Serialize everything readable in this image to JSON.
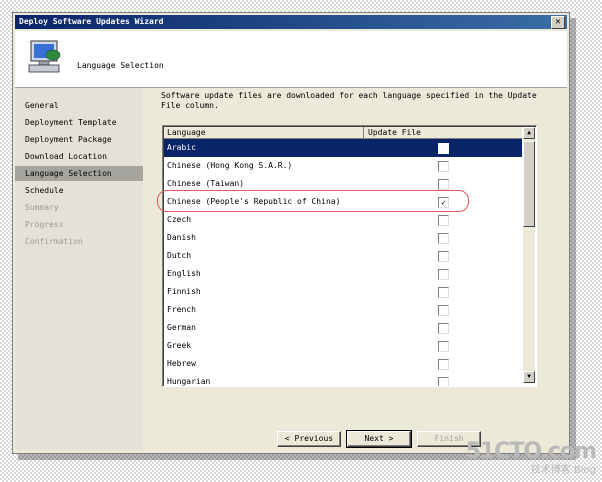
{
  "window": {
    "title": "Deploy Software Updates Wizard",
    "close_glyph": "✕"
  },
  "header": {
    "title": "Language Selection"
  },
  "sidebar": {
    "items": [
      {
        "label": "General",
        "state": "normal"
      },
      {
        "label": "Deployment Template",
        "state": "normal"
      },
      {
        "label": "Deployment Package",
        "state": "normal"
      },
      {
        "label": "Download Location",
        "state": "normal"
      },
      {
        "label": "Language Selection",
        "state": "active"
      },
      {
        "label": "Schedule",
        "state": "normal"
      },
      {
        "label": "Summary",
        "state": "disabled"
      },
      {
        "label": "Progress",
        "state": "disabled"
      },
      {
        "label": "Confirmation",
        "state": "disabled"
      }
    ]
  },
  "main": {
    "description": "Software update files are downloaded for each language specified in the Update File column.",
    "columns": {
      "language": "Language",
      "update_file": "Update File"
    },
    "rows": [
      {
        "language": "Arabic",
        "checked": false,
        "selected": true
      },
      {
        "language": "Chinese (Hong Kong S.A.R.)",
        "checked": false,
        "selected": false
      },
      {
        "language": "Chinese (Taiwan)",
        "checked": false,
        "selected": false
      },
      {
        "language": "Chinese (People's Republic of China)",
        "checked": true,
        "selected": false
      },
      {
        "language": "Czech",
        "checked": false,
        "selected": false
      },
      {
        "language": "Danish",
        "checked": false,
        "selected": false
      },
      {
        "language": "Dutch",
        "checked": false,
        "selected": false
      },
      {
        "language": "English",
        "checked": false,
        "selected": false
      },
      {
        "language": "Finnish",
        "checked": false,
        "selected": false
      },
      {
        "language": "French",
        "checked": false,
        "selected": false
      },
      {
        "language": "German",
        "checked": false,
        "selected": false
      },
      {
        "language": "Greek",
        "checked": false,
        "selected": false
      },
      {
        "language": "Hebrew",
        "checked": false,
        "selected": false
      },
      {
        "language": "Hungarian",
        "checked": false,
        "selected": false
      }
    ],
    "check_glyph": "✓"
  },
  "buttons": {
    "previous": "< Previous",
    "next": "Next >",
    "finish": "Finish"
  },
  "watermark": {
    "brand": "51CTO.com",
    "sub": "技术博客 Blog"
  },
  "colors": {
    "title_bar": "#0a246a",
    "selection": "#0a246a",
    "highlight_ring": "#e05a5a"
  }
}
